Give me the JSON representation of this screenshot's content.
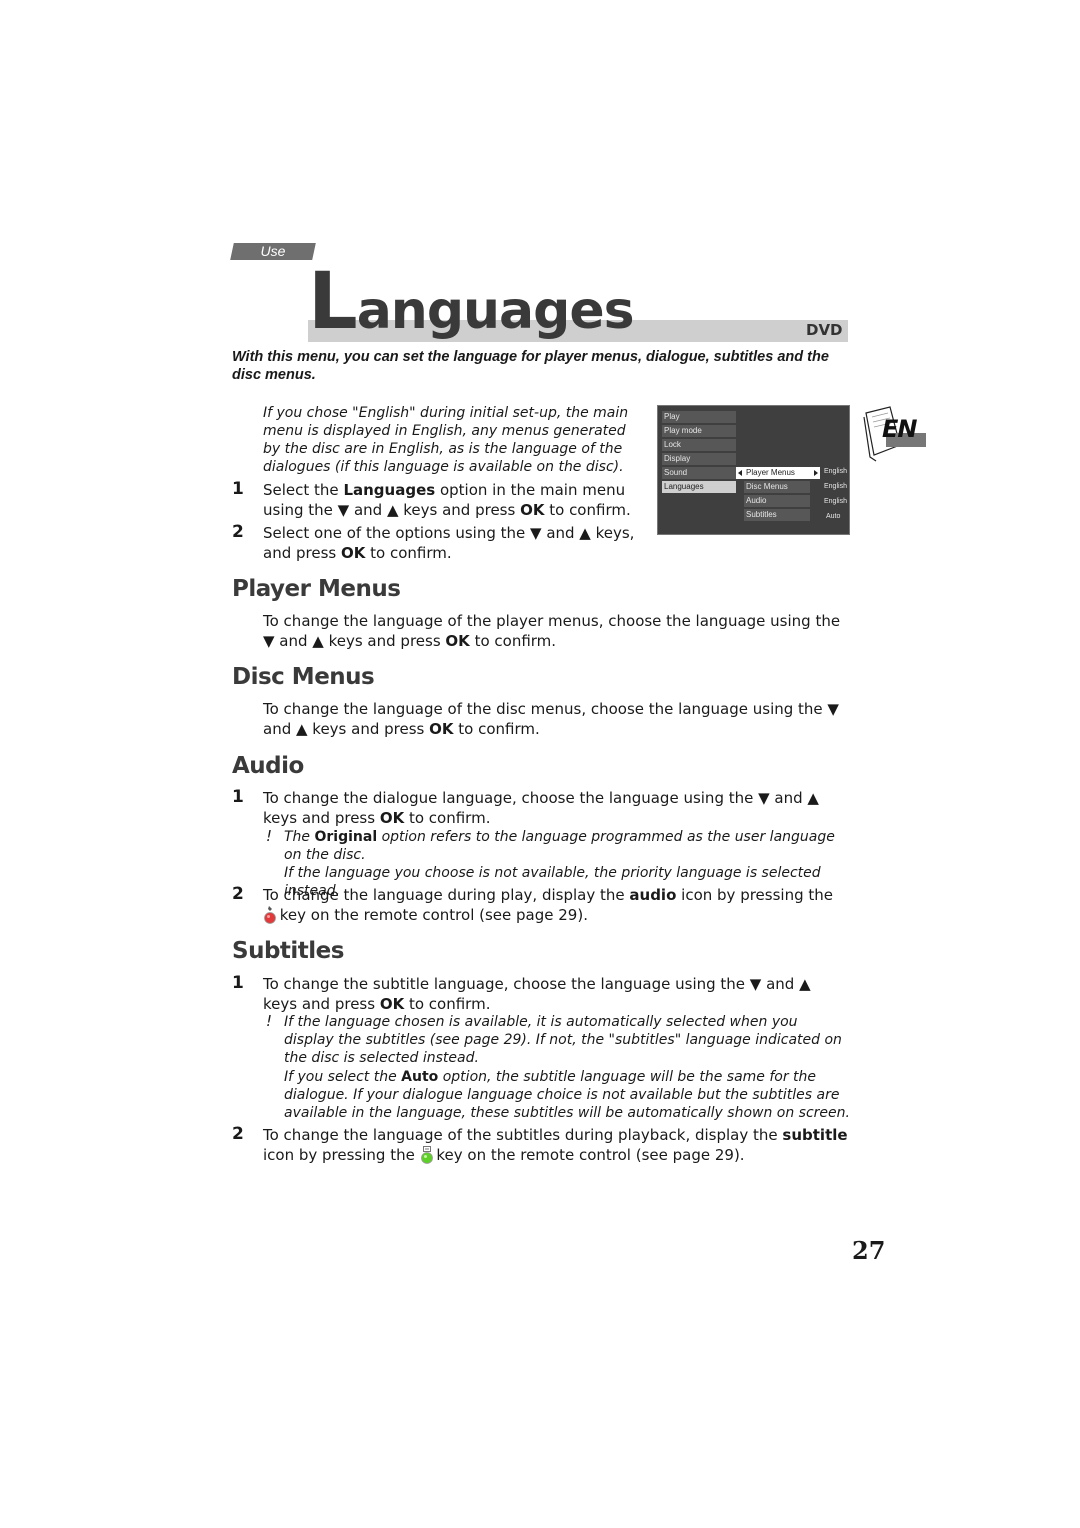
{
  "header": {
    "section_tab": "Use",
    "title_first_letter": "L",
    "title_rest": "anguages",
    "media_badge": "DVD",
    "language_badge": "EN"
  },
  "intro": "With this menu, you can set the language for player menus, dialogue, subtitles and the disc menus.",
  "setup_note": "If you chose \"English\" during initial set-up, the main menu is displayed in English, any menus generated by the disc are in English, as is the language of the dialogues (if this language is available on the disc).",
  "steps": [
    {
      "num": "1",
      "pre": "Select the ",
      "kw": "Languages",
      "mid": " option in the main menu using the ▼ and ▲ keys and press ",
      "kw2": "OK",
      "post": " to confirm."
    },
    {
      "num": "2",
      "pre": "Select one of the options using the ▼ and ▲ keys, and press ",
      "kw": "OK",
      "post": " to confirm."
    }
  ],
  "menu_screen": {
    "main_items": [
      "Play",
      "Play mode",
      "Lock",
      "Display",
      "Sound",
      "Languages"
    ],
    "selected_main": "Languages",
    "sub_items": [
      "Player Menus",
      "Disc Menus",
      "Audio",
      "Subtitles"
    ],
    "highlighted_sub": "Player Menus",
    "values": [
      "English",
      "English",
      "English",
      "Auto"
    ]
  },
  "sections": {
    "player_menus": {
      "heading": "Player Menus",
      "text_pre": "To change the language of the player menus, choose the language using the ▼ and ▲ keys and press ",
      "kw": "OK",
      "text_post": " to confirm."
    },
    "disc_menus": {
      "heading": "Disc Menus",
      "text_pre": "To change the language of the disc menus, choose the language using the ▼ and ▲ keys and press ",
      "kw": "OK",
      "text_post": " to confirm."
    },
    "audio": {
      "heading": "Audio",
      "step1_num": "1",
      "step1_pre": "To change the dialogue language, choose the language using the ▼ and ▲ keys and press ",
      "step1_kw": "OK",
      "step1_post": " to confirm.",
      "note_mark": "!",
      "note1_pre": "The ",
      "note1_kw": "Original",
      "note1_post": " option refers to the language programmed as the user language on the disc.",
      "note2": "If the language you choose is not available, the priority language is selected instead.",
      "step2_num": "2",
      "step2_pre": "To change the language during play, display the ",
      "step2_kw": "audio",
      "step2_mid": " icon by pressing the ",
      "step2_post": " key on the remote control (see page 29)."
    },
    "subtitles": {
      "heading": "Subtitles",
      "step1_num": "1",
      "step1_pre": "To change the subtitle language, choose the language using the ▼ and ▲ keys and press ",
      "step1_kw": "OK",
      "step1_post": " to confirm.",
      "note_mark": "!",
      "note1": "If the language chosen is available, it is automatically selected when you display the subtitles (see page 29). If not, the \"subtitles\" language indicated on the disc is selected instead.",
      "note2_pre": "If you select the ",
      "note2_kw": "Auto",
      "note2_post": " option, the subtitle language will be the same for the dialogue. If your dialogue language choice is not available but the subtitles are available in the language, these subtitles will be automatically shown on screen.",
      "step2_num": "2",
      "step2_pre": "To change the language of the subtitles during playback, display the ",
      "step2_kw": "subtitle",
      "step2_mid": " icon by pressing the ",
      "step2_post": " key on the remote control (see page 29)."
    }
  },
  "colors": {
    "audio_key": "#e23a3a",
    "subtitle_key": "#5fcf2a"
  },
  "page_number": "27"
}
